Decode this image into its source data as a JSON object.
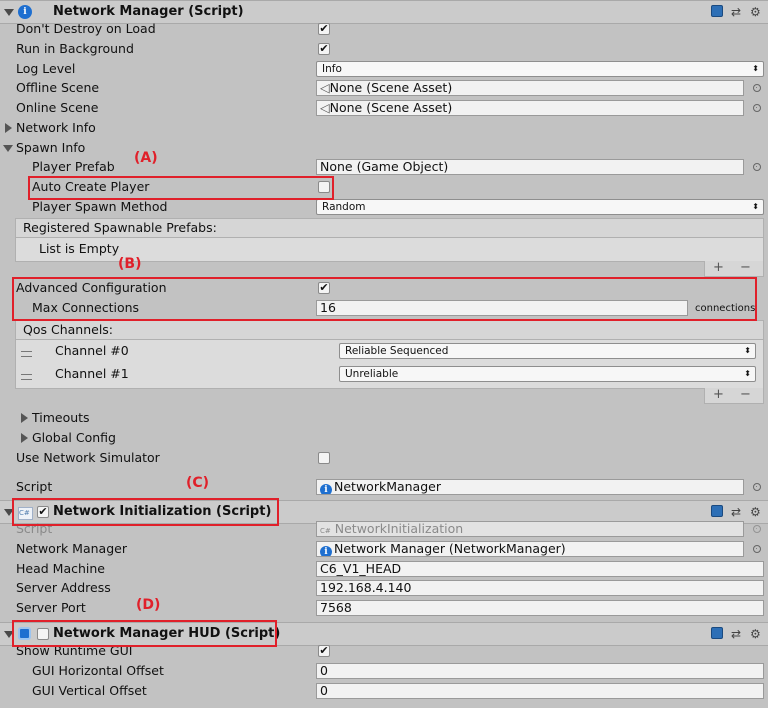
{
  "network_manager": {
    "title": "Network Manager (Script)",
    "dont_destroy_label": "Don't Destroy on Load",
    "run_in_background_label": "Run in Background",
    "log_level_label": "Log Level",
    "log_level_value": "Info",
    "offline_scene_label": "Offline Scene",
    "offline_scene_value": "None (Scene Asset)",
    "online_scene_label": "Online Scene",
    "online_scene_value": "None (Scene Asset)",
    "network_info_label": "Network Info",
    "spawn_info_label": "Spawn Info",
    "player_prefab_label": "Player Prefab",
    "player_prefab_value": "None (Game Object)",
    "auto_create_player_label": "Auto Create Player",
    "player_spawn_method_label": "Player Spawn Method",
    "player_spawn_method_value": "Random",
    "registered_prefabs_label": "Registered Spawnable Prefabs:",
    "list_empty_label": "List is Empty",
    "advanced_config_label": "Advanced Configuration",
    "max_connections_label": "Max Connections",
    "max_connections_value": "16",
    "connections_unit": "connections",
    "qos_channels_label": "Qos Channels:",
    "channels": [
      {
        "label": "Channel #0",
        "value": "Reliable Sequenced"
      },
      {
        "label": "Channel #1",
        "value": "Unreliable"
      }
    ],
    "timeouts_label": "Timeouts",
    "global_config_label": "Global Config",
    "use_network_simulator_label": "Use Network Simulator",
    "script_label": "Script",
    "script_value": "NetworkManager"
  },
  "network_initialization": {
    "title": "Network Initialization (Script)",
    "script_label": "Script",
    "script_value": "NetworkInitialization",
    "network_manager_label": "Network Manager",
    "network_manager_value": "Network Manager (NetworkManager)",
    "head_machine_label": "Head Machine",
    "head_machine_value": "C6_V1_HEAD",
    "server_address_label": "Server Address",
    "server_address_value": "192.168.4.140",
    "server_port_label": "Server Port",
    "server_port_value": "7568"
  },
  "network_manager_hud": {
    "title": "Network Manager HUD (Script)",
    "show_runtime_gui_label": "Show Runtime GUI",
    "gui_h_offset_label": "GUI Horizontal Offset",
    "gui_h_offset_value": "0",
    "gui_v_offset_label": "GUI Vertical Offset",
    "gui_v_offset_value": "0"
  },
  "annotations": {
    "a": "(A)",
    "b": "(B)",
    "c": "(C)",
    "d": "(D)"
  },
  "glyphs": {
    "check": "✔",
    "plus": "+",
    "minus": "−",
    "dd_arrow": "⬍",
    "info": "i",
    "cs": "C#"
  },
  "colors": {
    "highlight": "#e0202a",
    "info_icon": "#1e6fd0"
  }
}
